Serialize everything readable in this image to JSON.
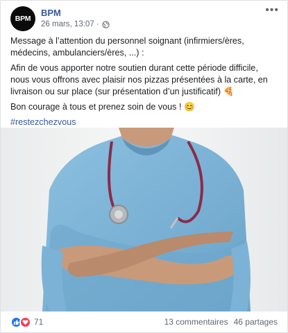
{
  "post": {
    "page_name": "BPM",
    "avatar_text": "BPM",
    "timestamp": "26 mars, 13:07 ·",
    "more_label": "•••",
    "paragraphs": [
      "Message à l’attention du personnel soignant (infirmiers/ères, médecins, ambulanciers/ères, ...) :",
      "Afin de vous apporter notre soutien durant cette période difficile, nous vous offrons avec plaisir nos pizzas présentées à la carte, en livraison ou sur place (sur présentation d’un justificatif) 🍕",
      "Bon courage à tous et prenez soin de vous ! 😊"
    ],
    "hashtag": "#restezchezvous"
  },
  "footer": {
    "reaction_count": "71",
    "comments": "13 commentaires",
    "shares": "46 partages"
  },
  "colors": {
    "link_blue": "#385898",
    "like_blue": "#1877f2",
    "love_red": "#f33e58",
    "scrubs": "#7fb3d6"
  }
}
